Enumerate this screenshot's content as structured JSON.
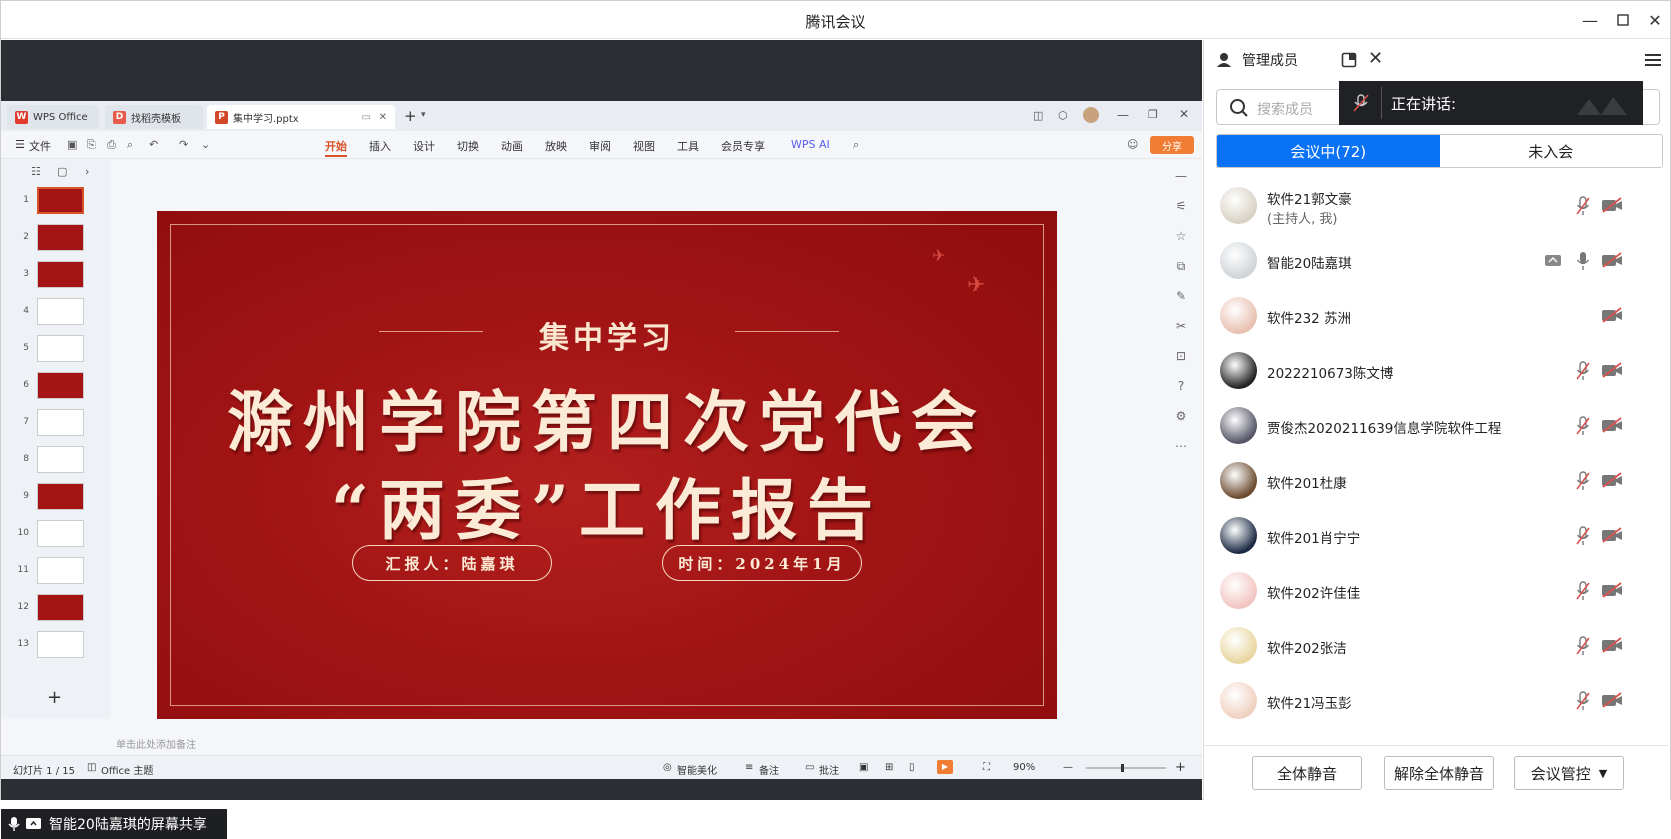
{
  "window": {
    "title": "腾讯会议"
  },
  "wps": {
    "tabs": [
      {
        "label": "WPS Office"
      },
      {
        "label": "找稻壳模板"
      },
      {
        "label": "集中学习.pptx"
      }
    ],
    "file_menu": "文件",
    "ribbon": [
      "开始",
      "插入",
      "设计",
      "切换",
      "动画",
      "放映",
      "审阅",
      "视图",
      "工具",
      "会员专享"
    ],
    "wps_ai": "WPS AI",
    "share_label": "分享",
    "thumb_numbers": [
      "1",
      "2",
      "3",
      "4",
      "5",
      "6",
      "7",
      "8",
      "9",
      "10",
      "11",
      "12",
      "13"
    ],
    "notes_placeholder": "单击此处添加备注",
    "status": {
      "slide_count": "幻灯片 1 / 15",
      "theme": "Office 主题",
      "beautify": "智能美化",
      "notes": "备注",
      "comments": "批注",
      "zoom": "90%"
    },
    "slide": {
      "subtitle": "集中学习",
      "title_line1": "滁州学院第四次党代会",
      "title_line2": "“两委”工作报告",
      "reporter": "汇报人：陆嘉琪",
      "time": "时间：2024年1月"
    }
  },
  "share_label": "智能20陆嘉琪的屏幕共享",
  "panel": {
    "title": "管理成员",
    "search_placeholder": "搜索成员",
    "speaking_label": "正在讲话:",
    "tabs": [
      {
        "label": "会议中(72)"
      },
      {
        "label": "未入会"
      }
    ],
    "members": [
      {
        "name": "软件21郭文豪",
        "sub": "(主持人, 我)",
        "mic": "muted",
        "cam": "off",
        "share": false
      },
      {
        "name": "智能20陆嘉琪",
        "sub": "",
        "mic": "on",
        "cam": "off",
        "share": true
      },
      {
        "name": "软件232 苏洲",
        "sub": "",
        "mic": "none",
        "cam": "off",
        "share": false
      },
      {
        "name": "2022210673陈文博",
        "sub": "",
        "mic": "muted",
        "cam": "off",
        "share": false
      },
      {
        "name": "贾俊杰2020211639信息学院软件工程",
        "sub": "",
        "mic": "muted",
        "cam": "off",
        "share": false
      },
      {
        "name": "软件201杜康",
        "sub": "",
        "mic": "muted",
        "cam": "off",
        "share": false
      },
      {
        "name": "软件201肖宁宁",
        "sub": "",
        "mic": "muted",
        "cam": "off",
        "share": false
      },
      {
        "name": "软件202许佳佳",
        "sub": "",
        "mic": "muted",
        "cam": "off",
        "share": false
      },
      {
        "name": "软件202张洁",
        "sub": "",
        "mic": "muted",
        "cam": "off",
        "share": false
      },
      {
        "name": "软件21冯玉彭",
        "sub": "",
        "mic": "muted",
        "cam": "off",
        "share": false
      }
    ],
    "buttons": {
      "mute_all": "全体静音",
      "unmute_all": "解除全体静音",
      "meeting_control": "会议管控"
    }
  },
  "colors": {
    "accent": "#0a72f5",
    "muted": "#d9534f",
    "wps_accent": "#d9532a"
  }
}
